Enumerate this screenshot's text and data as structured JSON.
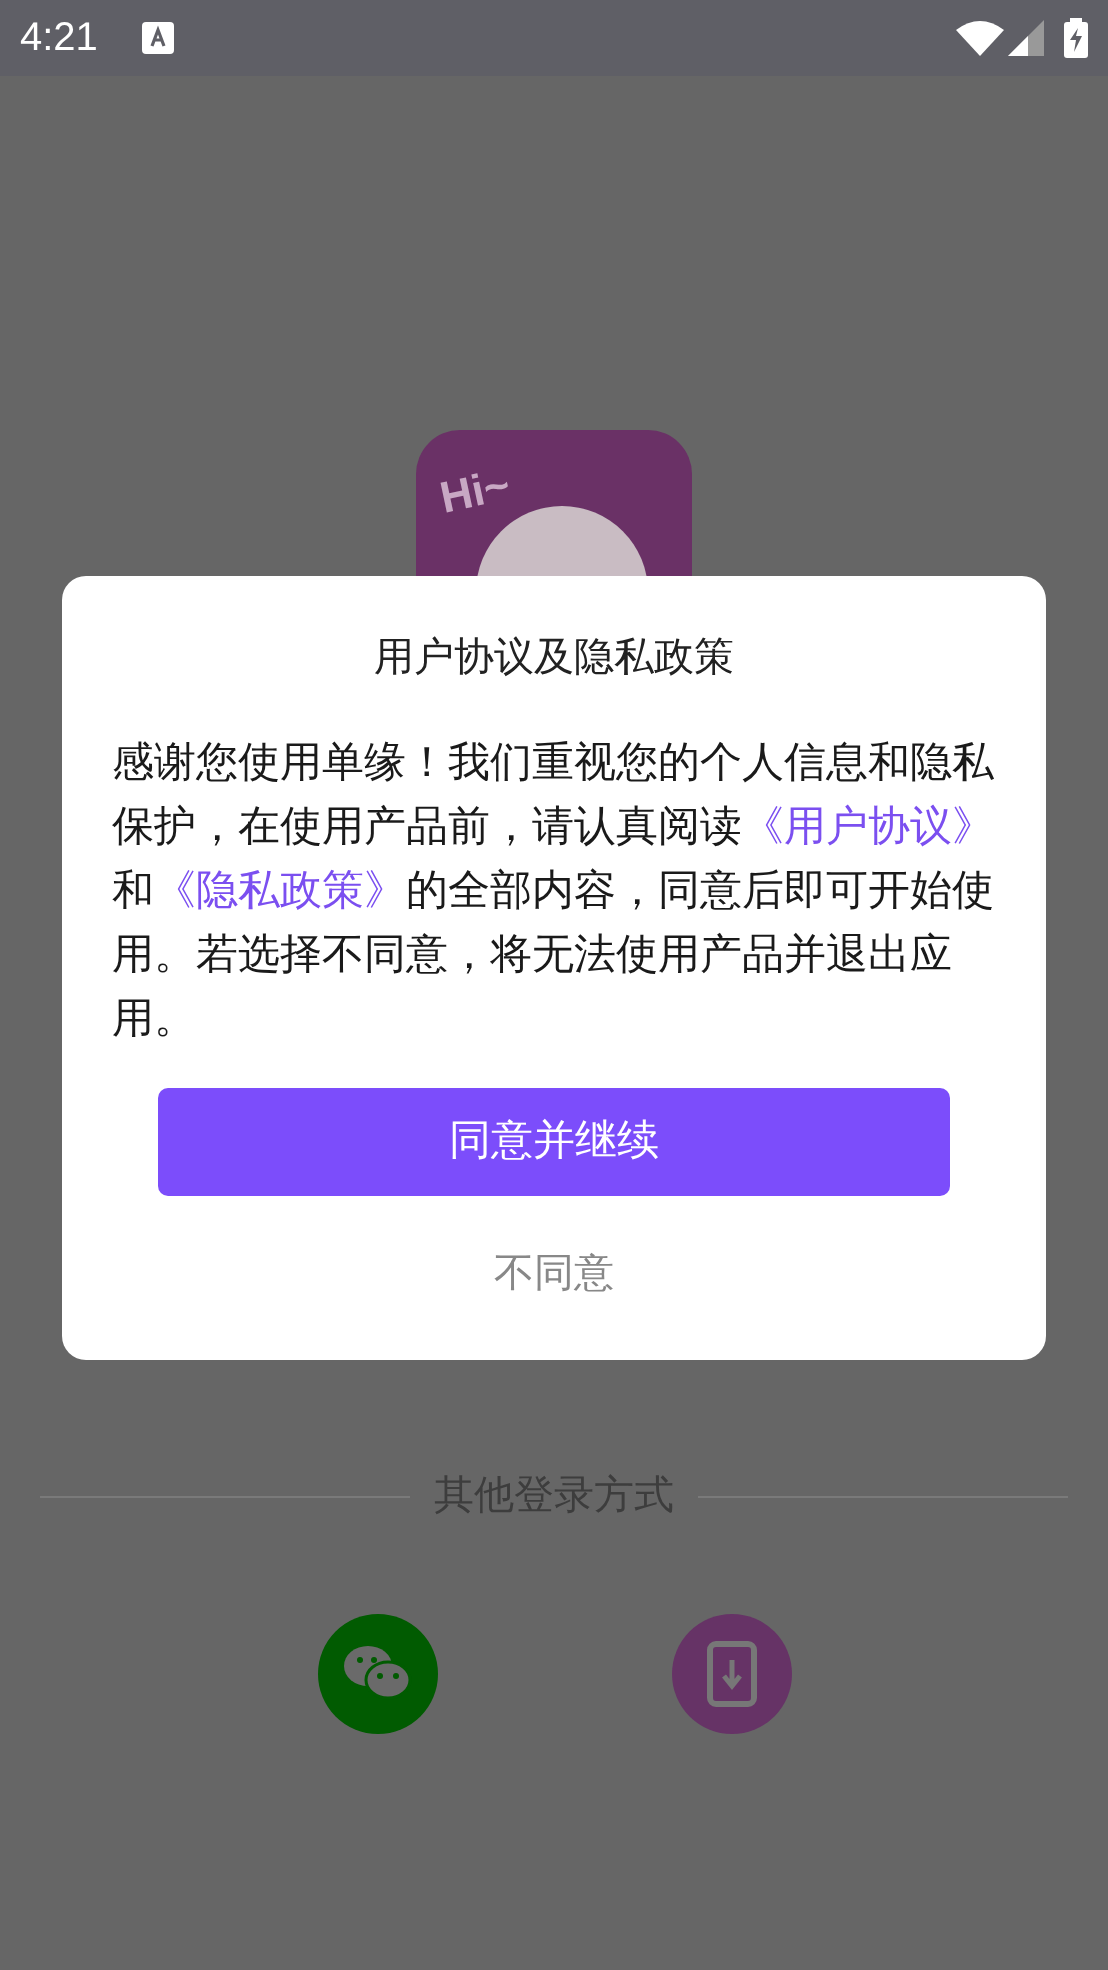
{
  "status_bar": {
    "time": "4:21"
  },
  "app_logo": {
    "text": "Hi~"
  },
  "dialog": {
    "title": "用户协议及隐私政策",
    "body": [
      {
        "kind": "text",
        "text": "感谢您使用单缘！我们重视您的个人信息和隐私保护，在使用产品前，请认真阅读"
      },
      {
        "kind": "link",
        "text": "《用户协议》"
      },
      {
        "kind": "text",
        "text": "和"
      },
      {
        "kind": "link",
        "text": "《隐私政策》"
      },
      {
        "kind": "text",
        "text": "的全部内容，同意后即可开始使用。若选择不同意，将无法使用产品并退出应用。"
      }
    ],
    "agree_button": "同意并继续",
    "decline_button": "不同意"
  },
  "other_login": {
    "label": "其他登录方式"
  }
}
